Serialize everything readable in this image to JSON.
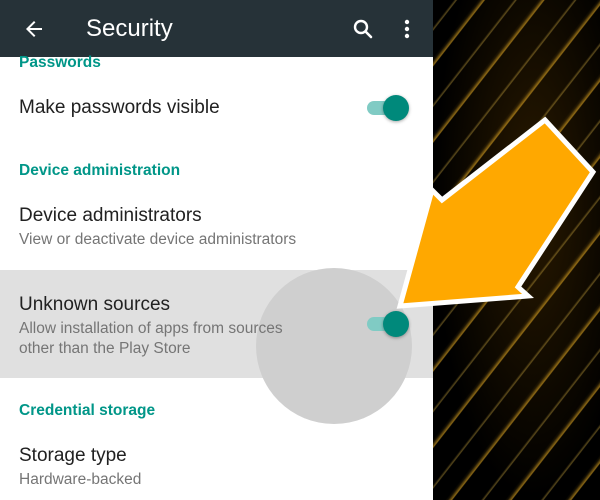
{
  "appbar": {
    "title": "Security",
    "icons": [
      "back-arrow-icon",
      "search-icon",
      "more-vert-icon"
    ],
    "background": "#263238"
  },
  "sections": {
    "passwords": {
      "header": "Passwords",
      "items": [
        {
          "title": "Make passwords visible",
          "toggle_on": true
        }
      ]
    },
    "device_administration": {
      "header": "Device administration",
      "items": [
        {
          "title": "Device administrators",
          "subtitle": "View or deactivate device administrators"
        },
        {
          "title": "Unknown sources",
          "subtitle_line1": "Allow installation of apps from sources",
          "subtitle_line2": "other than the Play Store",
          "toggle_on": true,
          "highlighted": true
        }
      ]
    },
    "credential_storage": {
      "header": "Credential storage",
      "items": [
        {
          "title": "Storage type",
          "subtitle": "Hardware-backed"
        }
      ]
    }
  },
  "colors": {
    "accent": "#009688",
    "toggle_thumb": "#00897b",
    "toggle_track": "#80cbc4",
    "highlight_row": "#e0e0e0",
    "annotation_arrow": "#FFA800"
  }
}
